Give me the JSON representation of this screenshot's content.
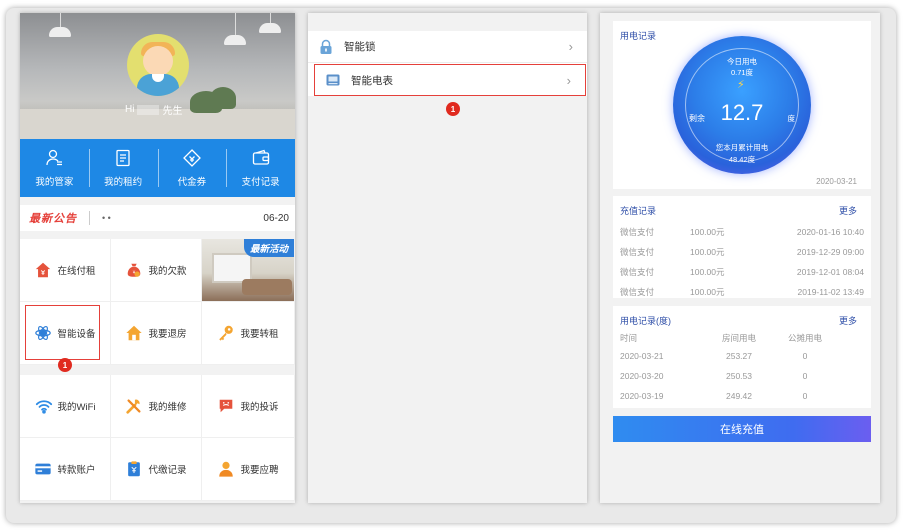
{
  "panel1": {
    "greeting_prefix": "Hi",
    "greeting_suffix": "先生",
    "quick_menu": [
      {
        "label": "我的管家",
        "icon": "butler-icon"
      },
      {
        "label": "我的租约",
        "icon": "lease-icon"
      },
      {
        "label": "代金券",
        "icon": "voucher-icon"
      },
      {
        "label": "支付记录",
        "icon": "wallet-icon"
      }
    ],
    "notice": {
      "brand": "最新公告",
      "text": "• •",
      "date": "06-20"
    },
    "promo_tag": "最新活动",
    "grid1": [
      {
        "label": "在线付租",
        "icon": "house-pay-icon"
      },
      {
        "label": "我的欠款",
        "icon": "money-bag-icon"
      },
      {
        "label": "智能设备",
        "icon": "smart-device-icon"
      },
      {
        "label": "我要退房",
        "icon": "house-icon"
      },
      {
        "label": "我要转租",
        "icon": "key-icon"
      }
    ],
    "grid2": [
      {
        "label": "我的WiFi",
        "icon": "wifi-icon"
      },
      {
        "label": "我的维修",
        "icon": "repair-icon"
      },
      {
        "label": "我的投诉",
        "icon": "complaint-icon"
      },
      {
        "label": "转款账户",
        "icon": "bank-card-icon"
      },
      {
        "label": "代缴记录",
        "icon": "payment-record-icon"
      },
      {
        "label": "我要应聘",
        "icon": "person-icon"
      }
    ],
    "step_badge": "1"
  },
  "panel2": {
    "items": [
      {
        "label": "智能锁",
        "icon": "lock-icon"
      },
      {
        "label": "智能电表",
        "icon": "meter-icon"
      }
    ],
    "chevron": "›",
    "step_badge": "1"
  },
  "panel3": {
    "usage_title": "用电记录",
    "gauge": {
      "today_label": "今日用电",
      "today_value": "0.71度",
      "remain_label": "剩余",
      "remain_value": "12.7",
      "remain_unit": "度",
      "month_label": "您本月累计用电",
      "month_value": "48.42度"
    },
    "gauge_date": "2020-03-21",
    "recharge": {
      "title": "充值记录",
      "more": "更多",
      "rows": [
        {
          "method": "微信支付",
          "amount": "100.00元",
          "time": "2020-01-16 10:40"
        },
        {
          "method": "微信支付",
          "amount": "100.00元",
          "time": "2019-12-29 09:00"
        },
        {
          "method": "微信支付",
          "amount": "100.00元",
          "time": "2019-12-01 08:04"
        },
        {
          "method": "微信支付",
          "amount": "100.00元",
          "time": "2019-11-02 13:49"
        }
      ]
    },
    "usage": {
      "title": "用电记录(度)",
      "more": "更多",
      "headers": [
        "时间",
        "房间用电",
        "公摊用电"
      ],
      "rows": [
        {
          "date": "2020-03-21",
          "room": "253.27",
          "shared": "0"
        },
        {
          "date": "2020-03-20",
          "room": "250.53",
          "shared": "0"
        },
        {
          "date": "2020-03-19",
          "room": "249.42",
          "shared": "0"
        }
      ]
    },
    "charge_button": "在线充值"
  }
}
